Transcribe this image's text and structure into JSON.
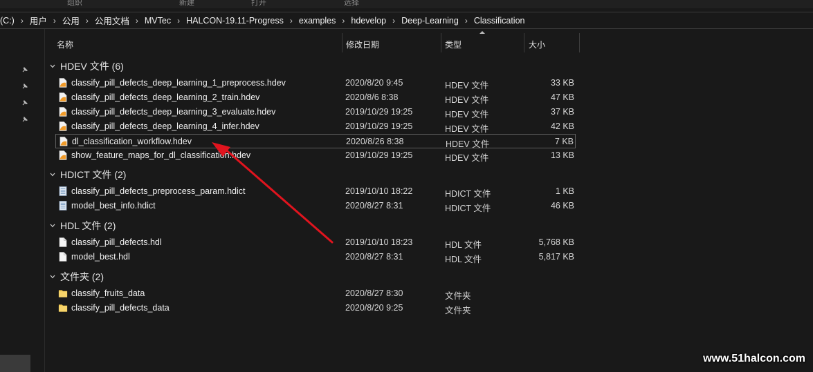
{
  "ribbon": {
    "labels": [
      "组织",
      "新建",
      "打开",
      "选择"
    ]
  },
  "address": {
    "crumbs": [
      "(C:)",
      "用户",
      "公用",
      "公用文档",
      "MVTec",
      "HALCON-19.11-Progress",
      "examples",
      "hdevelop",
      "Deep-Learning",
      "Classification"
    ]
  },
  "columns": {
    "name": "名称",
    "date": "修改日期",
    "type": "类型",
    "size": "大小"
  },
  "groups": [
    {
      "title": "HDEV 文件 (6)",
      "files": [
        {
          "name": "classify_pill_defects_deep_learning_1_preprocess.hdev",
          "date": "2020/8/20 9:45",
          "type": "HDEV 文件",
          "size": "33 KB"
        },
        {
          "name": "classify_pill_defects_deep_learning_2_train.hdev",
          "date": "2020/8/6 8:38",
          "type": "HDEV 文件",
          "size": "47 KB"
        },
        {
          "name": "classify_pill_defects_deep_learning_3_evaluate.hdev",
          "date": "2019/10/29 19:25",
          "type": "HDEV 文件",
          "size": "37 KB"
        },
        {
          "name": "classify_pill_defects_deep_learning_4_infer.hdev",
          "date": "2019/10/29 19:25",
          "type": "HDEV 文件",
          "size": "42 KB"
        },
        {
          "name": "dl_classification_workflow.hdev",
          "date": "2020/8/26 8:38",
          "type": "HDEV 文件",
          "size": "7 KB"
        },
        {
          "name": "show_feature_maps_for_dl_classification.hdev",
          "date": "2019/10/29 19:25",
          "type": "HDEV 文件",
          "size": "13 KB"
        }
      ]
    },
    {
      "title": "HDICT 文件 (2)",
      "files": [
        {
          "name": "classify_pill_defects_preprocess_param.hdict",
          "date": "2019/10/10 18:22",
          "type": "HDICT 文件",
          "size": "1 KB"
        },
        {
          "name": "model_best_info.hdict",
          "date": "2020/8/27 8:31",
          "type": "HDICT 文件",
          "size": "46 KB"
        }
      ]
    },
    {
      "title": "HDL 文件 (2)",
      "files": [
        {
          "name": "classify_pill_defects.hdl",
          "date": "2019/10/10 18:23",
          "type": "HDL 文件",
          "size": "5,768 KB"
        },
        {
          "name": "model_best.hdl",
          "date": "2020/8/27 8:31",
          "type": "HDL 文件",
          "size": "5,817 KB"
        }
      ]
    },
    {
      "title": "文件夹 (2)",
      "files": [
        {
          "name": "classify_fruits_data",
          "date": "2020/8/27 8:30",
          "type": "文件夹",
          "size": ""
        },
        {
          "name": "classify_pill_defects_data",
          "date": "2020/8/20 9:25",
          "type": "文件夹",
          "size": ""
        }
      ]
    }
  ],
  "selected_file": "dl_classification_workflow.hdev",
  "colors": {
    "background": "#191919",
    "arrow": "#e0141e",
    "folder": "#f3c94e",
    "hdev": "#f09a28"
  },
  "watermark": "www.51halcon.com"
}
